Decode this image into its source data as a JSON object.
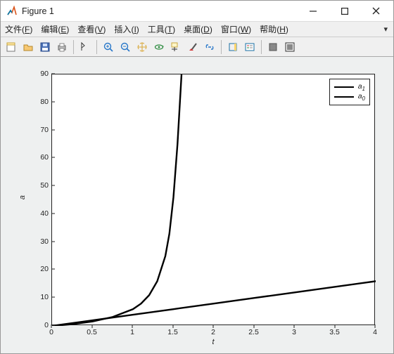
{
  "window": {
    "title": "Figure 1"
  },
  "menus": {
    "file": {
      "label": "文件",
      "accel": "F"
    },
    "edit": {
      "label": "编辑",
      "accel": "E"
    },
    "view": {
      "label": "查看",
      "accel": "V"
    },
    "insert": {
      "label": "插入",
      "accel": "I"
    },
    "tools": {
      "label": "工具",
      "accel": "T"
    },
    "desktop": {
      "label": "桌面",
      "accel": "D"
    },
    "window": {
      "label": "窗口",
      "accel": "W"
    },
    "help": {
      "label": "帮助",
      "accel": "H"
    }
  },
  "toolbar_icons": [
    "new-figure",
    "open",
    "save",
    "print",
    "arrow",
    "zoom-in",
    "zoom-out",
    "pan",
    "rotate3d",
    "data-cursor",
    "brush",
    "link",
    "colorbar",
    "legend",
    "dock",
    "undock"
  ],
  "chart_data": {
    "type": "line",
    "xlabel": "t",
    "ylabel": "a",
    "xlim": [
      0,
      4
    ],
    "ylim": [
      0,
      90
    ],
    "x_ticks": [
      0,
      0.5,
      1,
      1.5,
      2,
      2.5,
      3,
      3.5,
      4
    ],
    "y_ticks": [
      0,
      10,
      20,
      30,
      40,
      50,
      60,
      70,
      80,
      90
    ],
    "x_ticklabels": [
      "0",
      "0.5",
      "1",
      "1.5",
      "2",
      "2.5",
      "3",
      "3.5",
      "4"
    ],
    "y_ticklabels": [
      "0",
      "10",
      "20",
      "30",
      "40",
      "50",
      "60",
      "70",
      "80",
      "90"
    ],
    "legend": {
      "entries": [
        "a_1",
        "a_0"
      ],
      "position": "northeast"
    },
    "series": [
      {
        "name": "a_1",
        "x": [
          0,
          0.25,
          0.5,
          0.75,
          1.0,
          1.1,
          1.2,
          1.3,
          1.4,
          1.45,
          1.5,
          1.55,
          1.58,
          1.6
        ],
        "y": [
          0,
          0.6,
          1.6,
          3.2,
          6.0,
          8.0,
          11.0,
          16.0,
          25.0,
          33.0,
          46.0,
          65.0,
          80.0,
          90.0
        ]
      },
      {
        "name": "a_0",
        "x": [
          0,
          0.5,
          1.0,
          1.5,
          2.0,
          2.5,
          3.0,
          3.5,
          4.0
        ],
        "y": [
          0,
          2.0,
          4.0,
          6.0,
          8.0,
          10.0,
          12.0,
          14.0,
          16.0
        ]
      }
    ]
  }
}
